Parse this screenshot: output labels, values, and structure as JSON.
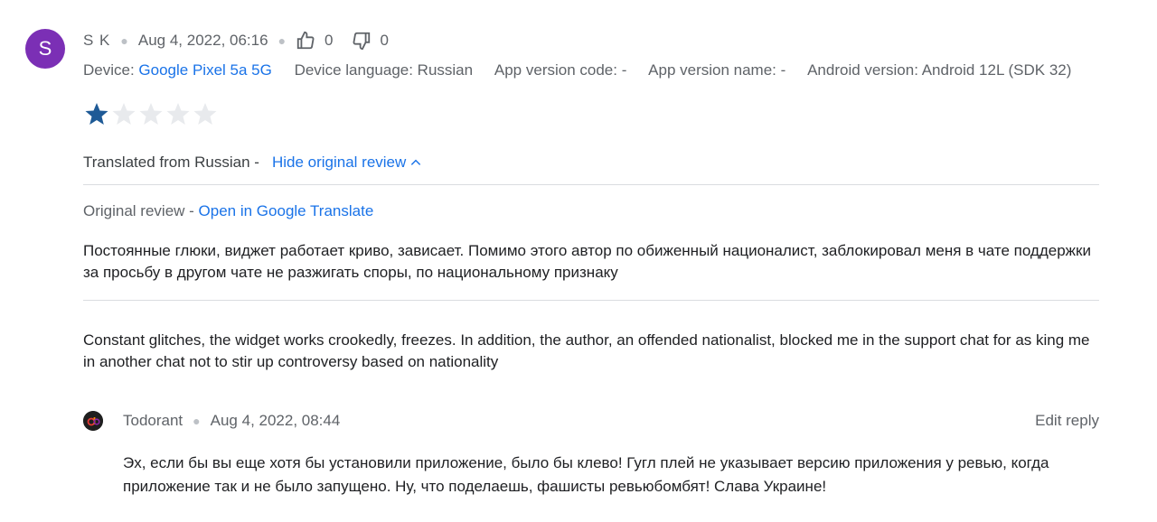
{
  "review": {
    "avatar_letter": "S",
    "author": "S K",
    "date": "Aug 4, 2022, 06:16",
    "thumbs_up_count": "0",
    "thumbs_down_count": "0",
    "device_label": "Device:",
    "device_name": "Google Pixel 5a 5G",
    "device_language": "Device language: Russian",
    "app_version_code": "App version code: -",
    "app_version_name": "App version name: -",
    "android_version": "Android version: Android 12L (SDK 32)",
    "rating": 1,
    "rating_max": 5,
    "translated_from": "Translated from Russian -",
    "hide_original_label": "Hide original review",
    "original_label": "Original review -",
    "open_translate_label": "Open in Google Translate",
    "original_text": "Постоянные глюки, виджет работает криво, зависает. Помимо этого автор по обиженный националист, заблокировал меня в чате поддержки за просьбу в другом чате не разжигать споры, по национальному признаку",
    "translated_text": "Constant glitches, the widget works crookedly, freezes. In addition, the author, an offended nationalist, blocked me in the support chat for as king me in another chat not to stir up controversy based on nationality"
  },
  "reply": {
    "author": "Todorant",
    "date": "Aug 4, 2022, 08:44",
    "edit_label": "Edit reply",
    "text": "Эх, если бы вы еще хотя бы установили приложение, было бы клево! Гугл плей не указывает версию приложения у ревью, когда приложение так и не было запущено. Ну, что поделаешь, фашисты ревьюбомбят! Слава Украине!"
  },
  "colors": {
    "avatar": "#7b2fb5",
    "star_filled": "#1e5a96",
    "star_empty": "#e8eaed",
    "link": "#1a73e8"
  }
}
